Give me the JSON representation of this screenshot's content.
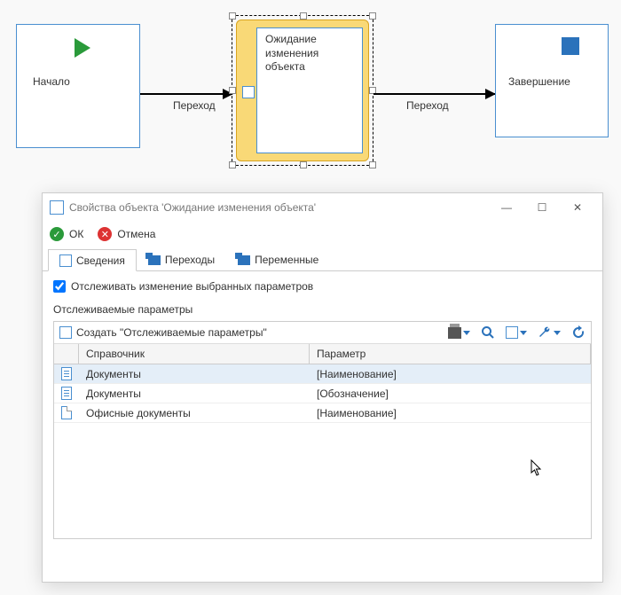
{
  "diagram": {
    "start": {
      "label": "Начало"
    },
    "wait": {
      "label": "Ожидание\nизменения\nобъекта"
    },
    "end": {
      "label": "Завершение"
    },
    "edge1": "Переход",
    "edge2": "Переход"
  },
  "dialog": {
    "title": "Свойства объекта 'Ожидание изменения объекта'",
    "ok": "ОК",
    "cancel": "Отмена",
    "tabs": {
      "t1": "Сведения",
      "t2": "Переходы",
      "t3": "Переменные"
    },
    "track_checkbox": "Отслеживать изменение выбранных параметров",
    "track_checked": true,
    "section": "Отслеживаемые параметры",
    "create": "Создать \"Отслеживаемые параметры\"",
    "columns": {
      "c1": "Справочник",
      "c2": "Параметр"
    },
    "rows": [
      {
        "icon": "doc-lines",
        "c1": "Документы",
        "c2": "[Наименование]",
        "selected": true
      },
      {
        "icon": "doc-lines",
        "c1": "Документы",
        "c2": "[Обозначение]",
        "selected": false
      },
      {
        "icon": "doc-plain",
        "c1": "Офисные документы",
        "c2": "[Наименование]",
        "selected": false
      }
    ]
  }
}
